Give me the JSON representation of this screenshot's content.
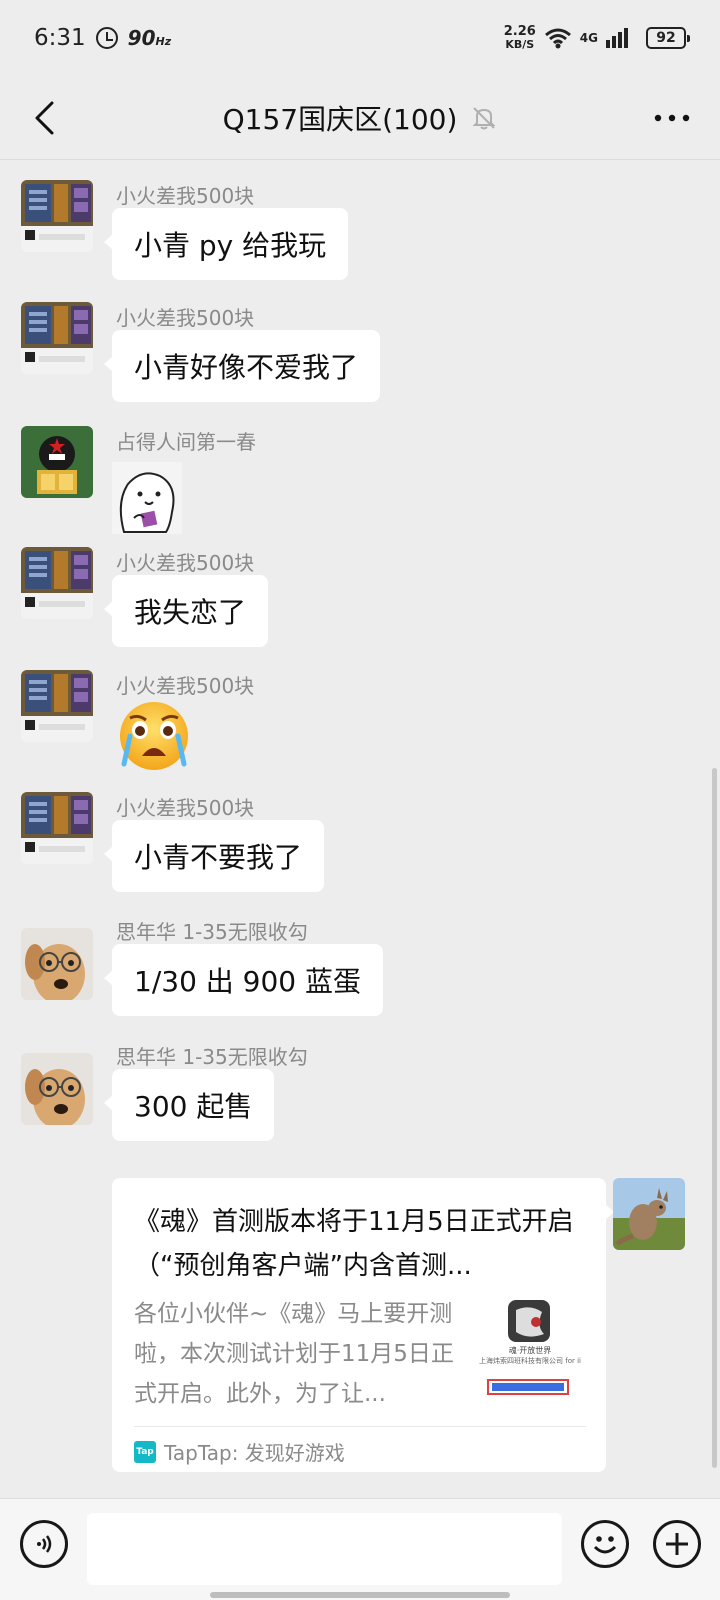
{
  "status_bar": {
    "time": "6:31",
    "refresh_rate": "90",
    "refresh_unit": "Hz",
    "net_speed_value": "2.26",
    "net_speed_unit": "KB/S",
    "network_type": "4G",
    "battery": "92"
  },
  "header": {
    "title": "Q157国庆区(100)",
    "icons": [
      "back-arrow-icon",
      "mute-bell-icon",
      "more-icon"
    ]
  },
  "messages": [
    {
      "sender": "小火差我500块",
      "text": "小青 py 给我玩",
      "avatar": "game-screenshot-avatar"
    },
    {
      "sender": "小火差我500块",
      "text": "小青好像不爱我了",
      "avatar": "game-screenshot-avatar"
    },
    {
      "sender": "占得人间第一春",
      "sticker": "white-blob-sticker",
      "avatar": "red-star-cap-avatar"
    },
    {
      "sender": "小火差我500块",
      "text": "我失恋了",
      "avatar": "game-screenshot-avatar"
    },
    {
      "sender": "小火差我500块",
      "emoji": "crying-face-emoji",
      "avatar": "game-screenshot-avatar"
    },
    {
      "sender": "小火差我500块",
      "text": "小青不要我了",
      "avatar": "game-screenshot-avatar"
    },
    {
      "sender": "思年华  1-35无限收勾",
      "text": "1/30 出 900 蓝蛋",
      "avatar": "dog-with-glasses-avatar"
    },
    {
      "sender": "思年华  1-35无限收勾",
      "text": "300 起售",
      "avatar": "dog-with-glasses-avatar"
    }
  ],
  "shared_card": {
    "title": "《魂》首测版本将于11月5日正式开启（“预创角客户端”内含首测...",
    "description": "各位小伙伴~《魂》马上要开测啦，本次测试计划于11月5日正式开启。此外，为了让...",
    "thumb_caption": "魂·开放世界",
    "thumb_company": "上海炜索四班科技有限公司 for ii",
    "source": "TapTap: 发现好游戏",
    "source_logo": "Tap"
  },
  "my_avatar": "kangaroo-avatar",
  "input_bar": {
    "placeholder": "",
    "icons": [
      "voice-icon",
      "emoji-icon",
      "plus-icon"
    ]
  },
  "colors": {
    "background": "#ededed",
    "bubble": "#ffffff",
    "sender": "#8a8a8a",
    "taptap": "#14b9c8"
  }
}
